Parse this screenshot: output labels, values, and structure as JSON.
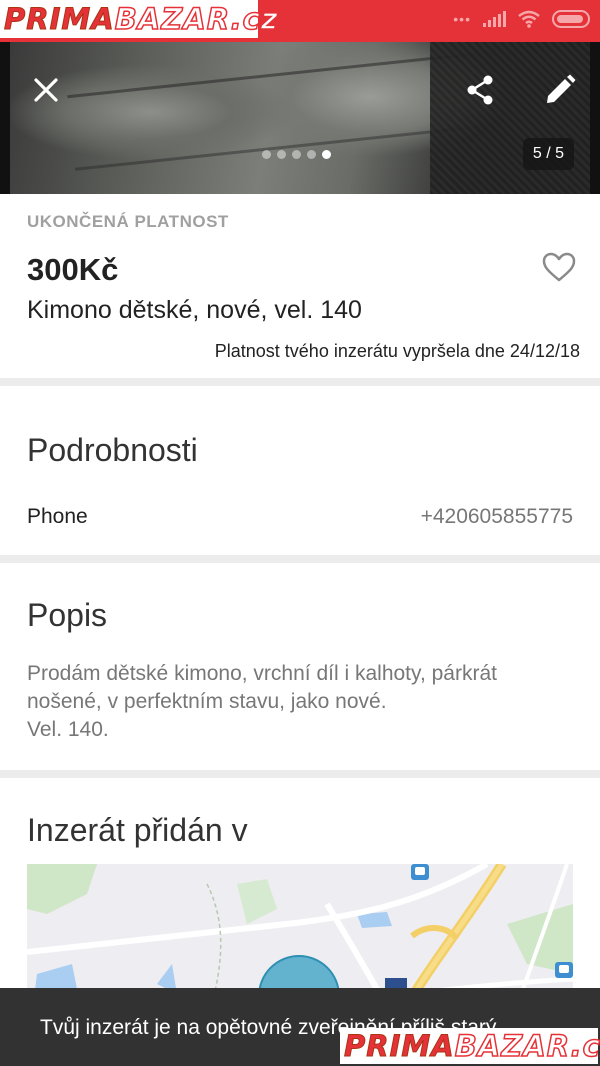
{
  "watermark": {
    "part1": "PRIMA",
    "part2": "BAZAR.cz"
  },
  "status_bar": {
    "dots": "•••"
  },
  "gallery": {
    "counter": "5 / 5",
    "total": 5,
    "current": 5
  },
  "listing": {
    "status": "UKONČENÁ PLATNOST",
    "price": "300Kč",
    "title": "Kimono dětské, nové, vel. 140",
    "expiry_note": "Platnost tvého inzerátu vypršela dne 24/12/18"
  },
  "details": {
    "heading": "Podrobnosti",
    "rows": [
      {
        "label": "Phone",
        "value": "+420605855775"
      }
    ]
  },
  "description": {
    "heading": "Popis",
    "text": "Prodám dětské kimono, vrchní díl i kalhoty, párkrát nošené, v perfektním stavu, jako nové.\n Vel. 140."
  },
  "location": {
    "heading": "Inzerát přidán v"
  },
  "snackbar": {
    "text": "Tvůj inzerát je na opětovné zveřejnění příliš starý"
  },
  "colors": {
    "brand_red": "#e53238",
    "snackbar_bg": "#323232",
    "divider": "#ececec"
  },
  "icons": [
    "close-icon",
    "share-icon",
    "edit-icon",
    "heart-icon",
    "wifi-icon",
    "signal-icon",
    "battery-icon",
    "metro-icon"
  ]
}
